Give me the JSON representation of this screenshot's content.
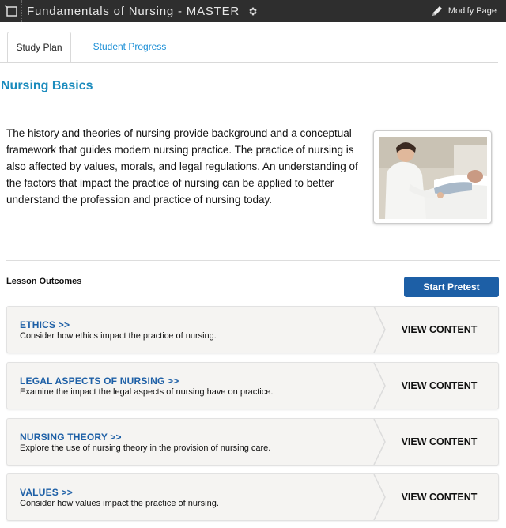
{
  "header": {
    "title": "Fundamentals of Nursing - MASTER",
    "modify_label": "Modify Page",
    "menu_icon": "sidebar-toggle-icon",
    "gear_icon": "gear-icon",
    "pencil_icon": "pencil-icon"
  },
  "tabs": [
    {
      "label": "Study Plan",
      "active": true
    },
    {
      "label": "Student Progress",
      "active": false
    }
  ],
  "section": {
    "title": "Nursing Basics",
    "intro": "The history and theories of nursing provide background and a conceptual framework that guides modern nursing practice. The practice of nursing is also affected by values, morals, and legal regulations. An understanding of the factors that impact the practice of nursing can be applied to better understand the profession and practice of nursing today."
  },
  "lesson_outcomes": {
    "label": "Lesson Outcomes",
    "pretest_label": "Start Pretest",
    "items": [
      {
        "title": "ETHICS >>",
        "description": "Consider how ethics impact the practice of nursing.",
        "action": "VIEW CONTENT"
      },
      {
        "title": "LEGAL ASPECTS OF NURSING >>",
        "description": "Examine the impact the legal aspects of nursing have on practice.",
        "action": "VIEW CONTENT"
      },
      {
        "title": "NURSING THEORY >>",
        "description": "Explore the use of nursing theory in the provision of nursing care.",
        "action": "VIEW CONTENT"
      },
      {
        "title": "VALUES >>",
        "description": "Consider how values impact the practice of nursing.",
        "action": "VIEW CONTENT"
      }
    ]
  },
  "colors": {
    "topbar": "#2e2e2e",
    "accent_blue": "#1d5fa6",
    "section_title": "#1a8bbd",
    "tab_link": "#1c8fd6"
  }
}
